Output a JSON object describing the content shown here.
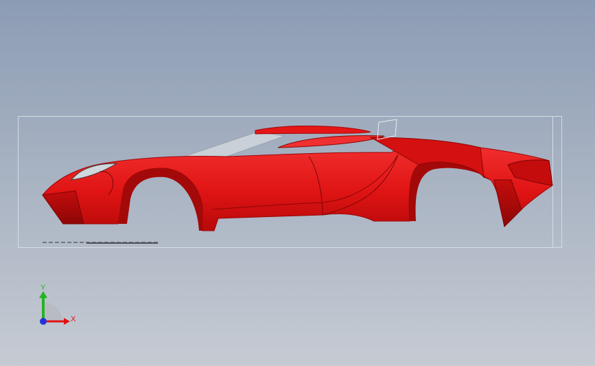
{
  "viewport": {
    "background_top": "#8c9cb4",
    "background_bottom": "#c6cbd3",
    "model_color": "#e01313",
    "model_shadow_color": "#b00808"
  },
  "model": {
    "icon": "car-body-model"
  },
  "triad": {
    "y_label": "Y",
    "x_label": "X",
    "y_color": "#22b322",
    "x_color": "#e01313",
    "z_color": "#2233dd"
  }
}
